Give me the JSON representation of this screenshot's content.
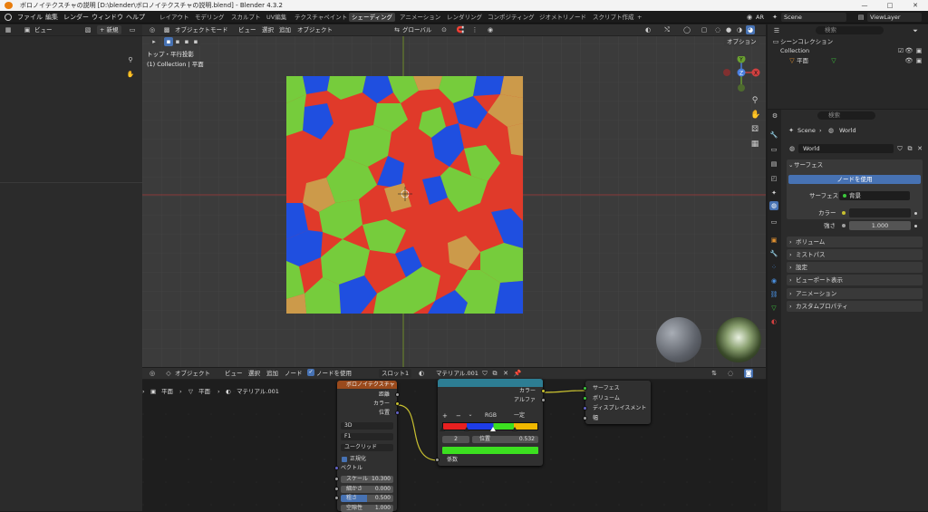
{
  "titlebar": {
    "title": "ボロノイテクスチャの説明 [D:\\blender\\ボロノイテクスチャの説明.blend] - Blender 4.3.2",
    "minimize": "—",
    "maximize": "□",
    "close": "✕"
  },
  "menu": [
    "ファイル",
    "編集",
    "レンダー",
    "ウィンドウ",
    "ヘルプ"
  ],
  "workspaces": [
    "レイアウト",
    "モデリング",
    "スカルプト",
    "UV編集",
    "テクスチャペイント",
    "シェーディング",
    "アニメーション",
    "レンダリング",
    "コンポジティング",
    "ジオメトリノード",
    "スクリプト作成"
  ],
  "top_right": {
    "ar": "AR",
    "scene": "Scene",
    "view_layer": "ViewLayer"
  },
  "left_header": {
    "view": "ビュー",
    "new": "+ 新規"
  },
  "viewport": {
    "mode": "オブジェクトモード",
    "menus": [
      "ビュー",
      "選択",
      "追加",
      "オブジェクト"
    ],
    "transform": "グローバル",
    "options": "オプション",
    "view_name": "トップ・平行投影",
    "collection_info": "(1) Collection | 平面",
    "gizmo": {
      "x": "X",
      "y": "Y",
      "z": "Z"
    }
  },
  "outliner": {
    "search": "検索",
    "scene_collection": "シーンコレクション",
    "collection": "Collection",
    "object": "平面"
  },
  "properties": {
    "search": "検索",
    "breadcrumb": [
      "Scene",
      "World"
    ],
    "world_name": "World",
    "surface_section": "サーフェス",
    "use_nodes": "ノードを使用",
    "surface_label": "サーフェス",
    "surface_value": "背景",
    "color_label": "カラー",
    "strength_label": "強さ",
    "strength_value": "1.000",
    "sections": [
      "ボリューム",
      "ミストパス",
      "設定",
      "ビューポート表示",
      "アニメーション",
      "カスタムプロパティ"
    ]
  },
  "node_editor": {
    "object": "オブジェクト",
    "menus": [
      "ビュー",
      "選択",
      "追加",
      "ノード"
    ],
    "use_nodes": "ノードを使用",
    "slot": "スロット1",
    "material": "マテリアル.001",
    "breadcrumb": [
      "平面",
      "平面",
      "マテリアル.001"
    ]
  },
  "voronoi_node": {
    "title": "ボロノイテクスチャ",
    "out_distance": "距離",
    "out_color": "カラー",
    "out_position": "位置",
    "dim": "3D",
    "feature": "F1",
    "metric": "ユークリッド",
    "normalize": "正規化",
    "vector": "ベクトル",
    "fields": [
      {
        "label": "スケール",
        "value": "10.300"
      },
      {
        "label": "細かさ",
        "value": "0.000"
      },
      {
        "label": "粗さ",
        "value": "0.500"
      },
      {
        "label": "空隙性",
        "value": "1.000"
      }
    ]
  },
  "ramp_node": {
    "out_color": "カラー",
    "out_alpha": "アルファ",
    "plus": "+",
    "minus": "−",
    "mode": "RGB",
    "interp": "一定",
    "index": "2",
    "pos_label": "位置",
    "pos_value": "0.532",
    "in_factor": "係数",
    "stops": [
      {
        "pos": 0.0,
        "color": "#e82020"
      },
      {
        "pos": 0.25,
        "color": "#1e3de8"
      },
      {
        "pos": 0.532,
        "color": "#3ce020"
      },
      {
        "pos": 0.75,
        "color": "#f0b800"
      }
    ]
  },
  "output_node": {
    "inputs": [
      "サーフェス",
      "ボリューム",
      "ディスプレイスメント",
      "幅"
    ]
  },
  "colors": {
    "red": "#e03a2a",
    "blue": "#1f4fe0",
    "green": "#76cc3c",
    "tan": "#cc9a4a",
    "accent": "#4772b3",
    "node_header_tex": "#9a4a1c",
    "node_header_conv": "#2d7d93"
  }
}
